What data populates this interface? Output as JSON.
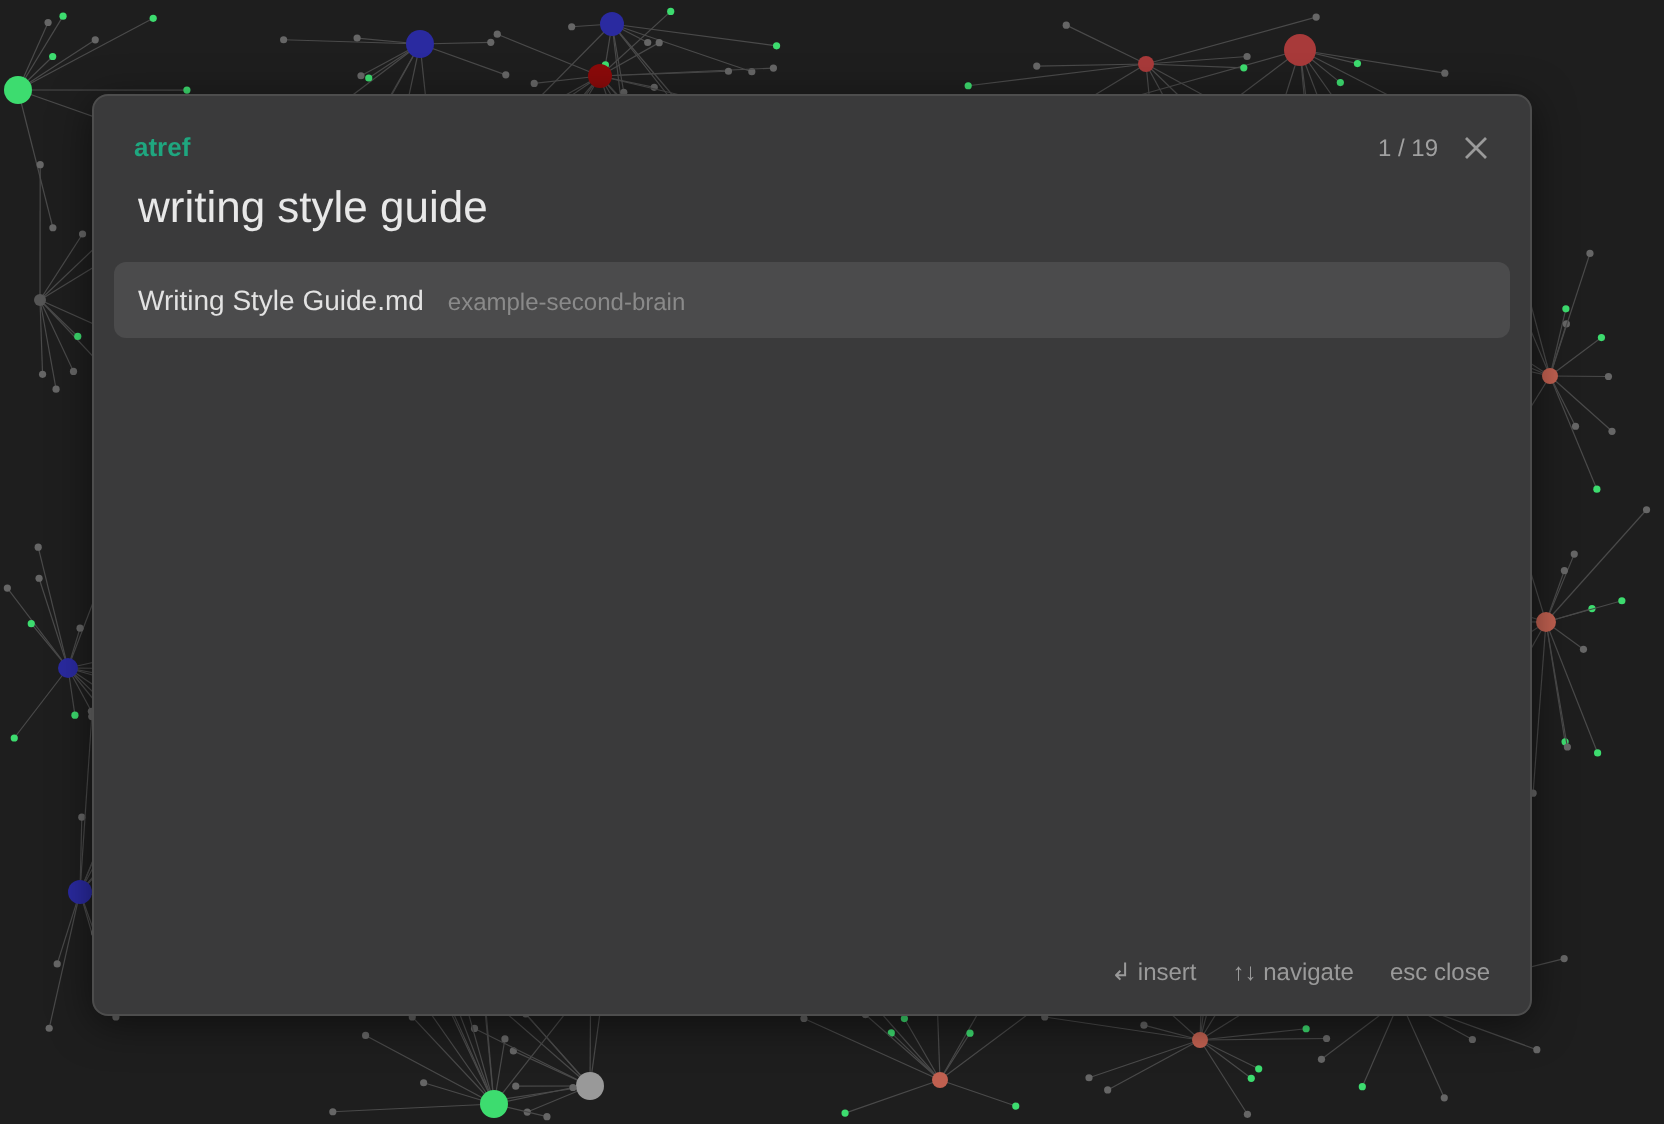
{
  "modal": {
    "plugin_label": "atref",
    "counter": "1 / 19",
    "query": "writing style guide",
    "results": [
      {
        "title": "Writing Style Guide.md",
        "path": "example-second-brain",
        "selected": true
      }
    ],
    "hints": [
      "↲ insert",
      "↑↓ navigate",
      "esc close"
    ]
  }
}
